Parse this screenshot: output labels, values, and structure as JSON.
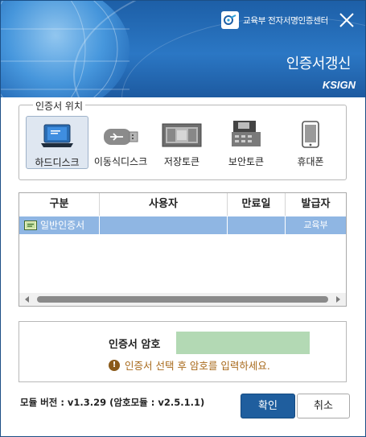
{
  "header": {
    "brand_text": "교육부 전자서명인증센터",
    "title": "인증서갱신",
    "ksign": "KSIGN"
  },
  "location": {
    "group_title": "인증서 위치",
    "items": [
      {
        "label": "하드디스크",
        "icon": "laptop-icon",
        "selected": true
      },
      {
        "label": "이동식디스크",
        "icon": "usb-icon",
        "selected": false
      },
      {
        "label": "저장토큰",
        "icon": "token-icon",
        "selected": false
      },
      {
        "label": "보안토큰",
        "icon": "secure-token-icon",
        "selected": false
      },
      {
        "label": "휴대폰",
        "icon": "phone-icon",
        "selected": false
      }
    ]
  },
  "table": {
    "columns": [
      "구분",
      "사용자",
      "만료일",
      "발급자"
    ],
    "rows": [
      {
        "type": "일반인증서",
        "user": "",
        "expiry": "",
        "issuer": "교육부",
        "selected": true
      }
    ]
  },
  "password": {
    "label": "인증서 암호",
    "value": "",
    "hint": "인증서 선택 후 암호를 입력하세요."
  },
  "footer": {
    "version": "모듈 버전 : v1.3.29 (암호모듈 : v2.5.1.1)",
    "ok_label": "확인",
    "cancel_label": "취소"
  },
  "colors": {
    "header_blue": "#2b77c4",
    "selected_row": "#8fb6e3",
    "ok_button": "#1f5e9e",
    "password_field": "#b3d9b4",
    "hint_text": "#a86a1c"
  }
}
